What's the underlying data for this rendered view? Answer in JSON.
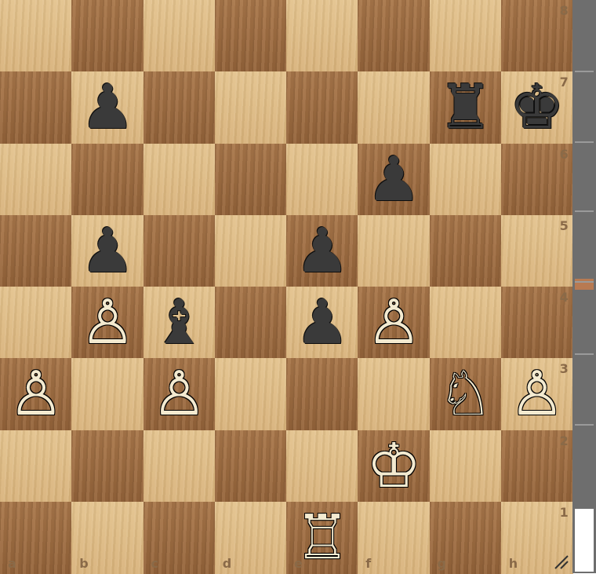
{
  "board": {
    "ranks": [
      "8",
      "7",
      "6",
      "5",
      "4",
      "3",
      "2",
      "1"
    ],
    "files": [
      "a",
      "b",
      "c",
      "d",
      "e",
      "f",
      "g",
      "h"
    ],
    "pieces": [
      {
        "square": "b7",
        "color": "black",
        "type": "pawn",
        "glyph": "♟"
      },
      {
        "square": "g7",
        "color": "black",
        "type": "rook",
        "glyph": "♜"
      },
      {
        "square": "h7",
        "color": "black",
        "type": "king",
        "glyph": "♚"
      },
      {
        "square": "f6",
        "color": "black",
        "type": "pawn",
        "glyph": "♟"
      },
      {
        "square": "b5",
        "color": "black",
        "type": "pawn",
        "glyph": "♟"
      },
      {
        "square": "e5",
        "color": "black",
        "type": "pawn",
        "glyph": "♟"
      },
      {
        "square": "b4",
        "color": "white",
        "type": "pawn",
        "glyph": "♙"
      },
      {
        "square": "c4",
        "color": "black",
        "type": "bishop",
        "glyph": "♝"
      },
      {
        "square": "e4",
        "color": "black",
        "type": "pawn",
        "glyph": "♟"
      },
      {
        "square": "f4",
        "color": "white",
        "type": "pawn",
        "glyph": "♙"
      },
      {
        "square": "a3",
        "color": "white",
        "type": "pawn",
        "glyph": "♙"
      },
      {
        "square": "c3",
        "color": "white",
        "type": "pawn",
        "glyph": "♙"
      },
      {
        "square": "g3",
        "color": "white",
        "type": "knight",
        "glyph": "♘"
      },
      {
        "square": "h3",
        "color": "white",
        "type": "pawn",
        "glyph": "♙"
      },
      {
        "square": "f2",
        "color": "white",
        "type": "king",
        "glyph": "♔"
      },
      {
        "square": "e1",
        "color": "white",
        "type": "rook",
        "glyph": "♖"
      }
    ]
  },
  "colors": {
    "light": "#dcb780",
    "dark": "#9e6c40",
    "scrollbar": "#6e6e6e",
    "marker": "#b87a52"
  },
  "icons": {
    "resize": "resize-grip-icon"
  }
}
